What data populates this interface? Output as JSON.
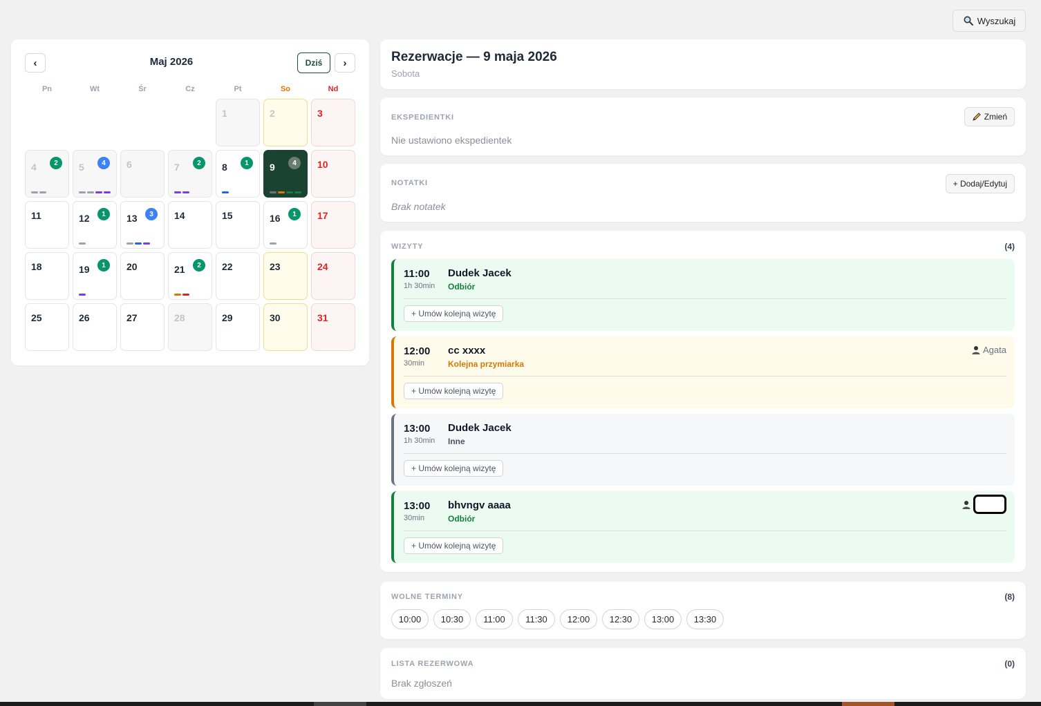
{
  "search": {
    "label": "Wyszukaj",
    "icon": "search-icon"
  },
  "calendar": {
    "month_title": "Maj 2026",
    "prev_label": "‹",
    "next_label": "›",
    "today_label": "Dziś",
    "weekdays": [
      "Pn",
      "Wt",
      "Śr",
      "Cz",
      "Pt",
      "So",
      "Nd"
    ],
    "days": [
      {
        "n": "",
        "kind": "empty"
      },
      {
        "n": "",
        "kind": "empty"
      },
      {
        "n": "",
        "kind": "empty"
      },
      {
        "n": "",
        "kind": "empty"
      },
      {
        "n": "1",
        "kind": "past"
      },
      {
        "n": "2",
        "kind": "past sat"
      },
      {
        "n": "3",
        "kind": "sun"
      },
      {
        "n": "4",
        "kind": "past",
        "badge": "2",
        "badge_color": "green",
        "bars": [
          "#9ca3af",
          "#9ca3af"
        ]
      },
      {
        "n": "5",
        "kind": "past",
        "badge": "4",
        "badge_color": "blue",
        "bars": [
          "#9ca3af",
          "#9ca3af",
          "#7c3aed",
          "#7c3aed"
        ]
      },
      {
        "n": "6",
        "kind": "past"
      },
      {
        "n": "7",
        "kind": "past",
        "badge": "2",
        "badge_color": "green",
        "bars": [
          "#7c3aed",
          "#7c3aed"
        ]
      },
      {
        "n": "8",
        "kind": "",
        "badge": "1",
        "badge_color": "green",
        "bars": [
          "#2563eb"
        ]
      },
      {
        "n": "9",
        "kind": "sel",
        "badge": "4",
        "badge_color": "grey",
        "bars": [
          "#6b7280",
          "#d97706",
          "#15803d",
          "#15803d"
        ]
      },
      {
        "n": "10",
        "kind": "sun"
      },
      {
        "n": "11",
        "kind": ""
      },
      {
        "n": "12",
        "kind": "",
        "badge": "1",
        "badge_color": "green",
        "bars": [
          "#9ca3af"
        ]
      },
      {
        "n": "13",
        "kind": "",
        "badge": "3",
        "badge_color": "blue",
        "bars": [
          "#9ca3af",
          "#2563eb",
          "#7c3aed"
        ]
      },
      {
        "n": "14",
        "kind": ""
      },
      {
        "n": "15",
        "kind": ""
      },
      {
        "n": "16",
        "kind": "sat-plain",
        "badge": "1",
        "badge_color": "green",
        "bars": [
          "#9ca3af"
        ]
      },
      {
        "n": "17",
        "kind": "sun"
      },
      {
        "n": "18",
        "kind": ""
      },
      {
        "n": "19",
        "kind": "",
        "badge": "1",
        "badge_color": "green",
        "bars": [
          "#7c3aed"
        ]
      },
      {
        "n": "20",
        "kind": ""
      },
      {
        "n": "21",
        "kind": "",
        "badge": "2",
        "badge_color": "green",
        "bars": [
          "#d97706",
          "#dc2626"
        ]
      },
      {
        "n": "22",
        "kind": ""
      },
      {
        "n": "23",
        "kind": "sat"
      },
      {
        "n": "24",
        "kind": "sun"
      },
      {
        "n": "25",
        "kind": ""
      },
      {
        "n": "26",
        "kind": ""
      },
      {
        "n": "27",
        "kind": ""
      },
      {
        "n": "28",
        "kind": "past"
      },
      {
        "n": "29",
        "kind": ""
      },
      {
        "n": "30",
        "kind": "sat"
      },
      {
        "n": "31",
        "kind": "sun"
      }
    ]
  },
  "header": {
    "title": "Rezerwacje — 9 maja 2026",
    "subtitle": "Sobota"
  },
  "ekspedientki": {
    "label": "EKSPEDIENTKI",
    "button": "Zmień",
    "empty": "Nie ustawiono ekspedientek"
  },
  "notatki": {
    "label": "NOTATKI",
    "button": "+ Dodaj/Edytuj",
    "empty": "Brak notatek"
  },
  "wizyty": {
    "label": "WIZYTY",
    "count": "(4)",
    "items": [
      {
        "time": "11:00",
        "duration": "1h 30min",
        "name": "Dudek Jacek",
        "type": "Odbiór",
        "color": "green",
        "staff": "",
        "button": "+ Umów kolejną wizytę"
      },
      {
        "time": "12:00",
        "duration": "30min",
        "name": "cc xxxx",
        "type": "Kolejna przymiarka",
        "color": "yellow",
        "staff": "Agata",
        "button": "+ Umów kolejną wizytę"
      },
      {
        "time": "13:00",
        "duration": "1h 30min",
        "name": "Dudek Jacek",
        "type": "Inne",
        "color": "gray",
        "staff": "",
        "button": "+ Umów kolejną wizytę"
      },
      {
        "time": "13:00",
        "duration": "30min",
        "name": "bhvngv aaaa",
        "type": "Odbiór",
        "color": "green",
        "staff": "",
        "redacted": true,
        "button": "+ Umów kolejną wizytę"
      }
    ]
  },
  "wolne": {
    "label": "WOLNE TERMINY",
    "count": "(8)",
    "slots": [
      "10:00",
      "10:30",
      "11:00",
      "11:30",
      "12:00",
      "12:30",
      "13:00",
      "13:30"
    ]
  },
  "lista": {
    "label": "LISTA REZERWOWA",
    "count": "(0)",
    "empty": "Brak zgłoszeń"
  }
}
